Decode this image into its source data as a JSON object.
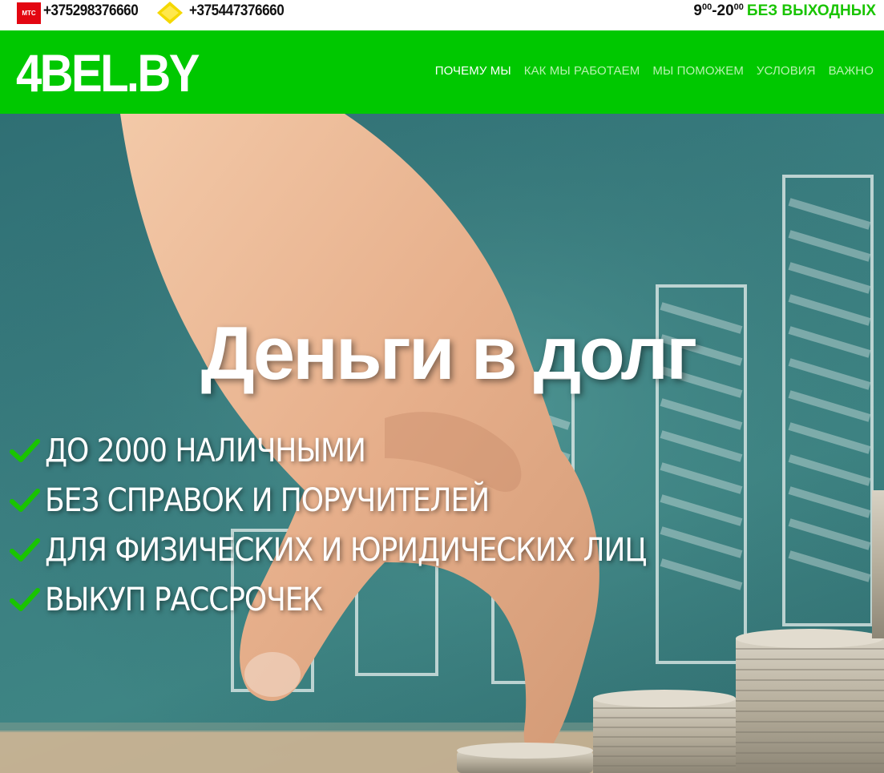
{
  "topbar": {
    "operator1_logo": "МТС",
    "phone1": "+375298376660",
    "operator2_logo_icon": "life-logo-icon",
    "phone2": "+375447376660",
    "hours_start": "9",
    "hours_start_min": "00",
    "hours_sep": "-",
    "hours_end": "20",
    "hours_end_min": "00",
    "no_days_off": "БЕЗ ВЫХОДНЫХ"
  },
  "header": {
    "brand": "4BEL.BY",
    "nav": [
      {
        "label": "ПОЧЕМУ МЫ",
        "active": true
      },
      {
        "label": "КАК МЫ РАБОТАЕМ",
        "active": false
      },
      {
        "label": "МЫ ПОМОЖЕМ",
        "active": false
      },
      {
        "label": "УСЛОВИЯ",
        "active": false
      },
      {
        "label": "ВАЖНО",
        "active": false
      }
    ]
  },
  "hero": {
    "title": "Деньги в долг",
    "features": [
      "ДО 2000 НАЛИЧНЫМИ",
      "БЕЗ СПРАВОК И ПОРУЧИТЕЛЕЙ",
      "ДЛЯ ФИЗИЧЕСКИХ И ЮРИДИЧЕСКИХ ЛИЦ",
      "ВЫКУП РАССРОЧЕК"
    ],
    "feature_icon": "check-icon"
  },
  "colors": {
    "brand_green": "#00c800",
    "accent_green": "#19c400",
    "mts_red": "#e30611",
    "life_yellow": "#f5d800",
    "nav_inactive": "#b8f2b0"
  }
}
